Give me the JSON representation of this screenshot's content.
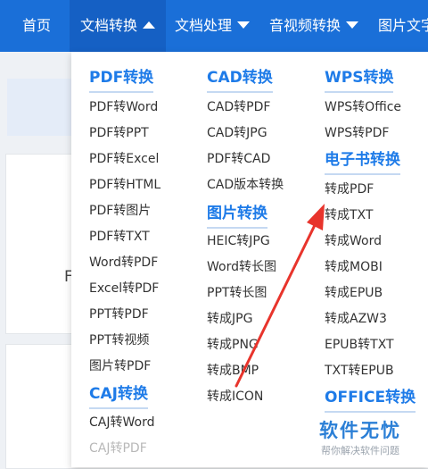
{
  "nav": {
    "items": [
      {
        "label": "首页",
        "caret": "none",
        "active": false
      },
      {
        "label": "文档转换",
        "caret": "up",
        "active": true
      },
      {
        "label": "文档处理",
        "caret": "down",
        "active": false
      },
      {
        "label": "音视频转换",
        "caret": "down",
        "active": false
      },
      {
        "label": "图片文字",
        "caret": "none",
        "active": false
      }
    ],
    "background_color": "#1a6fd8"
  },
  "background": {
    "partial_letter": "F"
  },
  "dropdown": {
    "col1": {
      "pdf_heading": "PDF转换",
      "pdf_links": [
        "PDF转Word",
        "PDF转PPT",
        "PDF转Excel",
        "PDF转HTML",
        "PDF转图片",
        "PDF转TXT",
        "Word转PDF",
        "Excel转PDF",
        "PPT转PDF",
        "PPT转视频",
        "图片转PDF"
      ],
      "caj_heading": "CAJ转换",
      "caj_links": [
        "CAJ转Word",
        "CAJ转PDF"
      ]
    },
    "col2": {
      "cad_heading": "CAD转换",
      "cad_links": [
        "CAD转PDF",
        "CAD转JPG",
        "PDF转CAD",
        "CAD版本转换"
      ],
      "img_heading": "图片转换",
      "img_links": [
        "HEIC转JPG",
        "Word转长图",
        "PPT转长图",
        "转成JPG",
        "转成PNG",
        "转成BMP",
        "转成ICON"
      ]
    },
    "col3": {
      "wps_heading": "WPS转换",
      "wps_links": [
        "WPS转Office",
        "WPS转PDF"
      ],
      "ebook_heading": "电子书转换",
      "ebook_links": [
        "转成PDF",
        "转成TXT",
        "转成Word",
        "转成MOBI",
        "转成EPUB",
        "转成AZW3",
        "EPUB转TXT",
        "TXT转EPUB"
      ],
      "office_heading": "OFFICE转换"
    },
    "heading_color": "#1e7be8"
  },
  "annotation": {
    "arrow_color": "#e8342c"
  },
  "watermark": {
    "title": "软件无忧",
    "subtitle": "帮你解决软件问题"
  }
}
